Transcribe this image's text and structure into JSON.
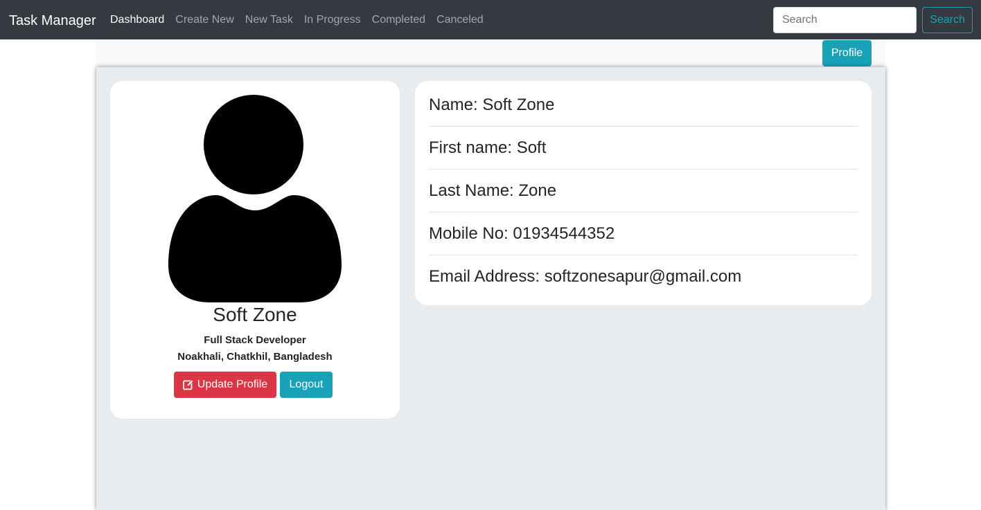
{
  "navbar": {
    "brand": "Task Manager",
    "links": [
      "Dashboard",
      "Create New",
      "New Task",
      "In Progress",
      "Completed",
      "Canceled"
    ],
    "search_placeholder": "Search",
    "search_button": "Search"
  },
  "subbar": {
    "profile_button": "Profile"
  },
  "profile_card": {
    "avatar_icon": "user-silhouette-icon",
    "name": "Soft Zone",
    "role": "Full Stack Developer",
    "location": "Noakhali, Chatkhil, Bangladesh",
    "update_button": "Update Profile",
    "update_icon": "edit-icon",
    "logout_button": "Logout"
  },
  "details": {
    "name": "Name: Soft Zone",
    "first_name": "First name: Soft",
    "last_name": "Last Name: Zone",
    "mobile": "Mobile No: 01934544352",
    "email": "Email Address: softzonesapur@gmail.com"
  },
  "colors": {
    "navbar_bg": "#343a40",
    "info": "#17a2b8",
    "danger": "#dc3545",
    "panel_bg": "#e9ecef"
  }
}
